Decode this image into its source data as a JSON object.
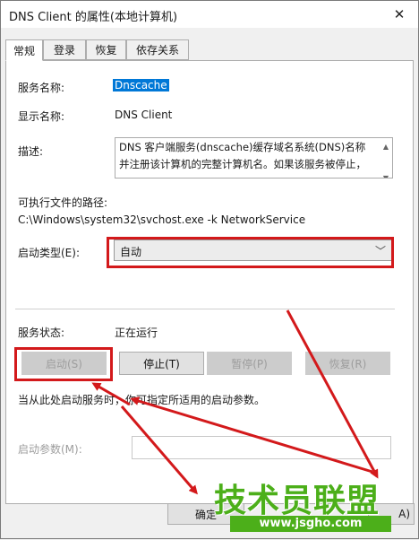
{
  "window": {
    "title": "DNS Client 的属性(本地计算机)",
    "close_glyph": "✕"
  },
  "tabs": [
    {
      "label": "常规",
      "active": true
    },
    {
      "label": "登录"
    },
    {
      "label": "恢复"
    },
    {
      "label": "依存关系"
    }
  ],
  "general": {
    "service_name_label": "服务名称:",
    "service_name_value": "Dnscache",
    "display_name_label": "显示名称:",
    "display_name_value": "DNS Client",
    "description_label": "描述:",
    "description_line1": "DNS 客户端服务(dnscache)缓存域名系统(DNS)名称",
    "description_line2": "并注册该计算机的完整计算机名。如果该服务被停止，",
    "exe_path_label": "可执行文件的路径:",
    "exe_path_value": "C:\\Windows\\system32\\svchost.exe -k NetworkService",
    "startup_type_label": "启动类型(E):",
    "startup_type_value": "自动",
    "status_label": "服务状态:",
    "status_value": "正在运行",
    "buttons": {
      "start": "启动(S)",
      "stop": "停止(T)",
      "pause": "暂停(P)",
      "resume": "恢复(R)"
    },
    "hint": "当从此处启动服务时，你可指定所适用的启动参数。",
    "start_params_label": "启动参数(M):",
    "start_params_value": ""
  },
  "footer": {
    "ok": "确定",
    "apply_partial": "A)"
  },
  "watermark": {
    "text": "技术员联盟",
    "url": "www.jsgho.com"
  },
  "colors": {
    "highlight": "#d3191b",
    "selection": "#0078d7",
    "watermark": "#4caf1a"
  }
}
